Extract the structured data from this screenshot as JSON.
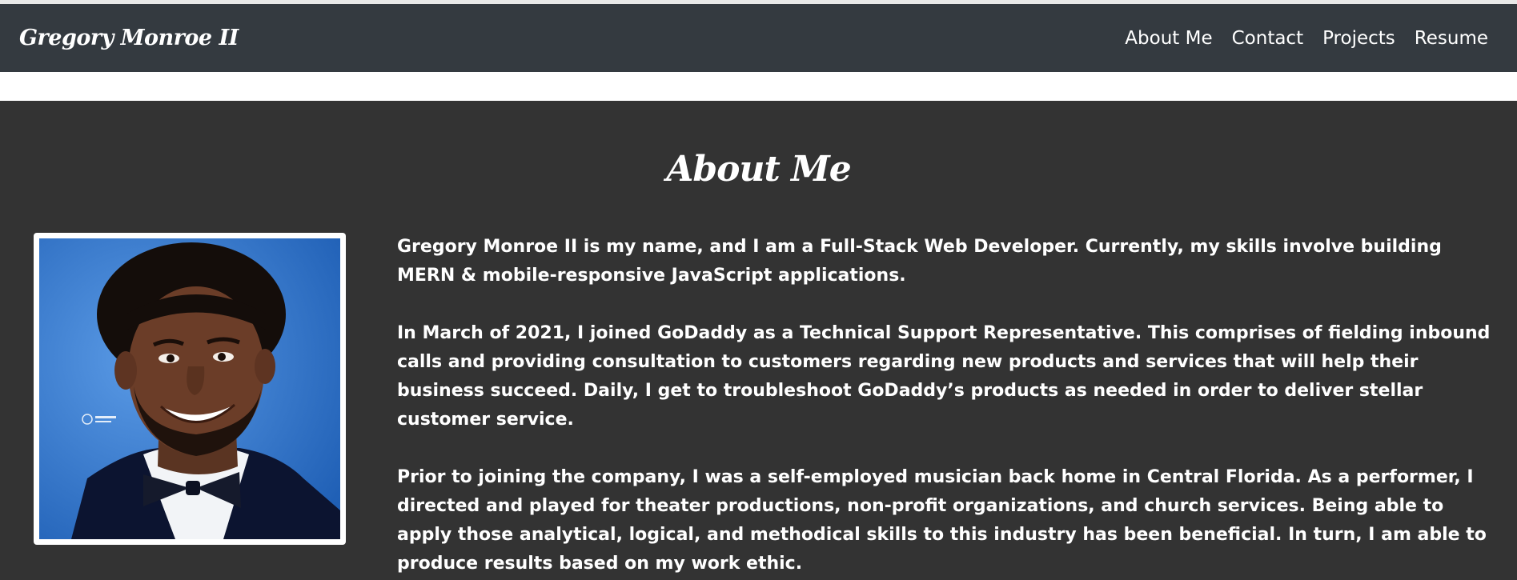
{
  "navbar": {
    "brand": "Gregory Monroe II",
    "links": [
      "About Me",
      "Contact",
      "Projects",
      "Resume"
    ]
  },
  "about": {
    "heading": "About Me",
    "photo_alt": "Portrait of Gregory Monroe II",
    "paragraphs": [
      "Gregory Monroe II is my name, and I am a Full-Stack Web Developer. Currently, my skills involve building MERN & mobile-responsive JavaScript applications.",
      "In March of 2021, I joined GoDaddy as a Technical Support Representative. This comprises of fielding inbound calls and providing consultation to customers regarding new products and services that will help their business succeed. Daily, I get to troubleshoot GoDaddy’s products as needed in order to deliver stellar customer service.",
      "Prior to joining the company, I was a self-employed musician back home in Central Florida. As a performer, I directed and played for theater productions, non-profit organizations, and church services. Being able to apply those analytical, logical, and methodical skills to this industry has been beneficial. In turn, I am able to produce results based on my work ethic."
    ]
  },
  "colors": {
    "navbar_bg": "#343a40",
    "section_bg": "#333333",
    "text": "#ffffff",
    "photo_bg": "#3d7fd4"
  }
}
